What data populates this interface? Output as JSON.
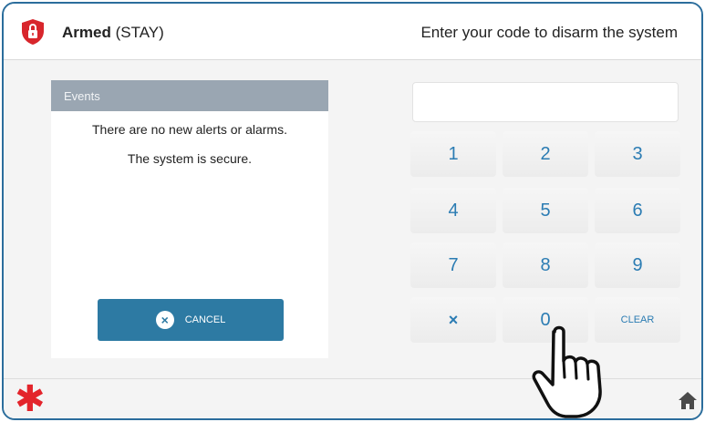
{
  "header": {
    "status_bold": "Armed",
    "status_mode": "(STAY)",
    "prompt": "Enter your code to disarm the system"
  },
  "events": {
    "title": "Events",
    "message_1": "There are no new alerts or alarms.",
    "message_2": "The system is secure."
  },
  "cancel": {
    "label": "CANCEL"
  },
  "code_input": {
    "value": ""
  },
  "keypad": {
    "keys": [
      "1",
      "2",
      "3",
      "4",
      "5",
      "6",
      "7",
      "8",
      "9",
      "×",
      "0",
      "CLEAR"
    ]
  },
  "colors": {
    "accent": "#2d7aa3",
    "key_text": "#2b7cb3",
    "alarm_red": "#e3242b",
    "events_header": "#9aa6b2"
  },
  "icons": {
    "status": "shield-lock-icon",
    "logo": "asterisk-icon",
    "home": "home-icon",
    "pointer": "hand-pointer-icon"
  }
}
